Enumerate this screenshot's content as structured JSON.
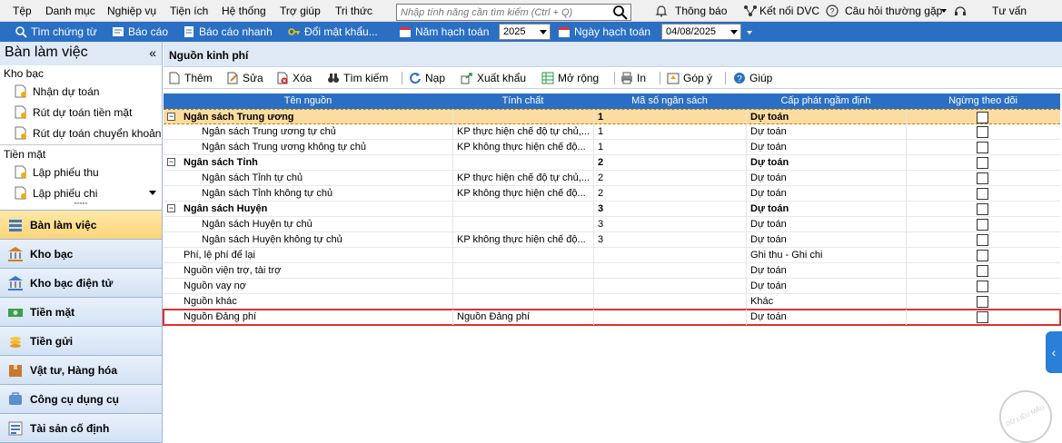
{
  "menu": [
    "Tệp",
    "Danh mục",
    "Nghiệp vụ",
    "Tiện ích",
    "Hệ thống",
    "Trợ giúp",
    "Tri thức"
  ],
  "search": {
    "placeholder": "Nhập tính năng cần tìm kiếm (Ctrl + Q)"
  },
  "topright": {
    "notify": "Thông báo",
    "dvc": "Kết nối DVC",
    "faq": "Câu hỏi thường gặp",
    "consult": "Tư vấn"
  },
  "toolbar": {
    "find_voucher": "Tìm chứng từ",
    "report": "Báo cáo",
    "quick_report": "Báo cáo nhanh",
    "change_pwd": "Đổi mật khẩu...",
    "fiscal_year_label": "Năm hạch toán",
    "fiscal_year_value": "2025",
    "date_label": "Ngày hạch toán",
    "date_value": "04/08/2025"
  },
  "sidebar": {
    "title": "Bàn làm việc",
    "groups": [
      {
        "name": "Kho bạc",
        "items": [
          "Nhận dự toán",
          "Rút dự toán tiền mặt",
          "Rút dự toán chuyển khoản"
        ]
      },
      {
        "name": "Tiền mặt",
        "items": [
          "Lập phiếu thu",
          "Lập phiếu chi"
        ]
      }
    ],
    "nav": [
      "Bàn làm việc",
      "Kho bạc",
      "Kho bạc điện tử",
      "Tiền mặt",
      "Tiền gửi",
      "Vật tư, Hàng hóa",
      "Công cụ dụng cụ",
      "Tài sản cố định"
    ]
  },
  "main": {
    "title": "Nguồn kinh phí",
    "actions": [
      "Thêm",
      "Sửa",
      "Xóa",
      "Tìm kiếm",
      "Nạp",
      "Xuất khẩu",
      "Mở rộng",
      "In",
      "Góp ý",
      "Giúp"
    ],
    "columns": [
      "Tên nguồn",
      "Tính chất",
      "Mã số ngân sách",
      "Cấp phát ngầm định",
      "Ngừng theo dõi"
    ],
    "rows": [
      {
        "name": "Ngân sách Trung ương",
        "prop": "",
        "code": "1",
        "alloc": "Dự toán",
        "level": 0,
        "group": true
      },
      {
        "name": "Ngân sách Trung ương tự chủ",
        "prop": "KP thực hiện chế độ tự chủ,...",
        "code": "1",
        "alloc": "Dự toán",
        "level": 1
      },
      {
        "name": "Ngân sách Trung ương không tự chủ",
        "prop": "KP không thực hiện chế độ...",
        "code": "1",
        "alloc": "Dự toán",
        "level": 1
      },
      {
        "name": "Ngân sách Tỉnh",
        "prop": "",
        "code": "2",
        "alloc": "Dự toán",
        "level": 0,
        "group": true
      },
      {
        "name": "Ngân sách Tỉnh tự chủ",
        "prop": "KP thực hiện chế độ tự chủ,...",
        "code": "2",
        "alloc": "Dự toán",
        "level": 1
      },
      {
        "name": "Ngân sách Tỉnh không tự chủ",
        "prop": "KP không thực hiện chế độ...",
        "code": "2",
        "alloc": "Dự toán",
        "level": 1
      },
      {
        "name": "Ngân sách Huyện",
        "prop": "",
        "code": "3",
        "alloc": "Dự toán",
        "level": 0,
        "group": true
      },
      {
        "name": "Ngân sách Huyện tự chủ",
        "prop": "",
        "code": "3",
        "alloc": "Dự toán",
        "level": 1
      },
      {
        "name": "Ngân sách Huyện không tự chủ",
        "prop": "KP không thực hiện chế độ...",
        "code": "3",
        "alloc": "Dự toán",
        "level": 1
      },
      {
        "name": "Phí, lệ phí để lại",
        "prop": "",
        "code": "",
        "alloc": "Ghi thu - Ghi chi",
        "level": 0
      },
      {
        "name": "Nguồn viện trợ, tài trợ",
        "prop": "",
        "code": "",
        "alloc": "Dự toán",
        "level": 0
      },
      {
        "name": "Nguồn vay nợ",
        "prop": "",
        "code": "",
        "alloc": "Dự toán",
        "level": 0
      },
      {
        "name": "Nguồn khác",
        "prop": "",
        "code": "",
        "alloc": "Khác",
        "level": 0
      },
      {
        "name": "Nguồn Đảng phí",
        "prop": "Nguồn Đảng phí",
        "code": "",
        "alloc": "Dự toán",
        "level": 0
      }
    ]
  },
  "watermark": "DỮ LIỆU MẪU",
  "colors": {
    "accent": "#2a6fc4",
    "selected_row": "#fcdca0",
    "highlight_border": "#e03030"
  }
}
